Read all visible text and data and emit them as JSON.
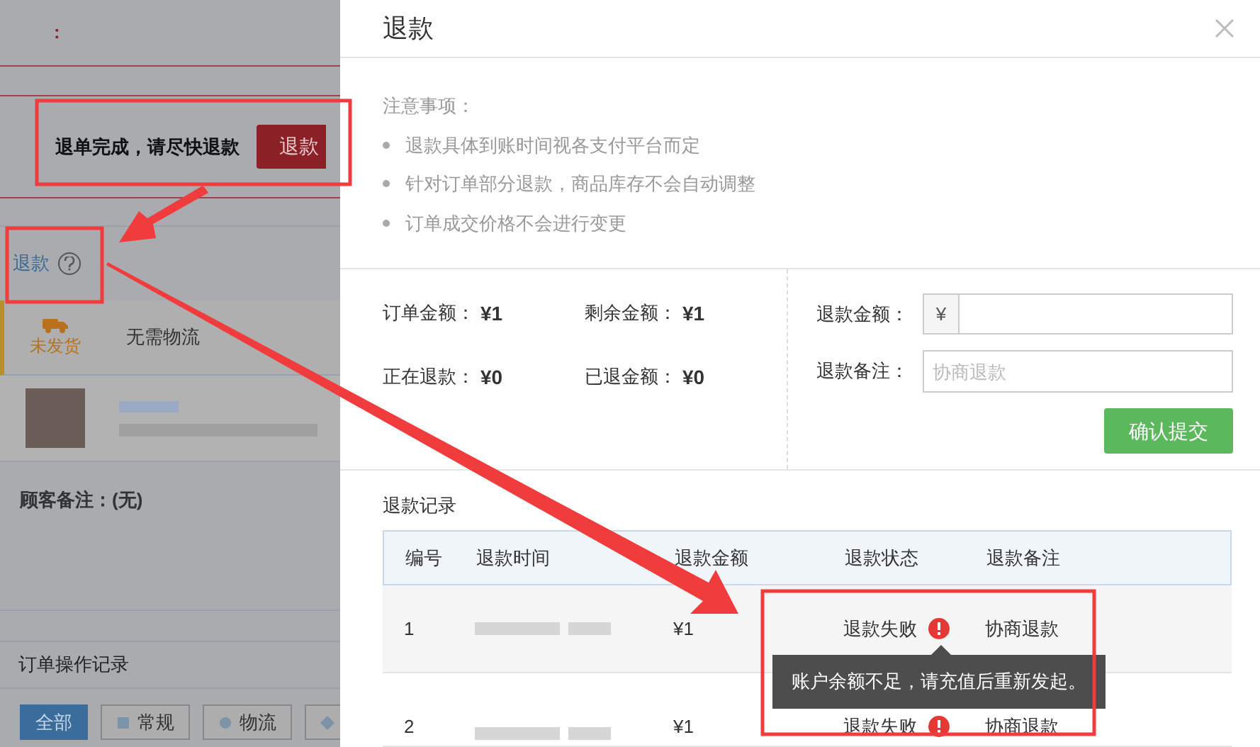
{
  "background_page": {
    "header_mark": ":",
    "banner": {
      "text": "退单完成，请尽快退款",
      "button": "退款"
    },
    "refund_link": "退款",
    "shipping": {
      "status": "未发货",
      "method": "无需物流"
    },
    "customer_note": "顾客备注：(无)",
    "log_title": "订单操作记录",
    "filters": [
      {
        "label": "全部",
        "selected": true,
        "kind": "plain"
      },
      {
        "label": "常规",
        "selected": false,
        "kind": "square"
      },
      {
        "label": "物流",
        "selected": false,
        "kind": "circle"
      },
      {
        "selected": false,
        "kind": "diamond"
      }
    ]
  },
  "dialog": {
    "title": "退款",
    "notes_title": "注意事项：",
    "notes": [
      "退款具体到账时间视各支付平台而定",
      "针对订单部分退款，商品库存不会自动调整",
      "订单成交价格不会进行变更"
    ],
    "amounts": [
      {
        "label": "订单金额：",
        "value": "¥1"
      },
      {
        "label": "剩余金额：",
        "value": "¥1"
      },
      {
        "label": "正在退款：",
        "value": "¥0"
      },
      {
        "label": "已退金额：",
        "value": "¥0"
      }
    ],
    "form": {
      "amount_label": "退款金额：",
      "currency": "¥",
      "note_label": "退款备注：",
      "note_placeholder": "协商退款",
      "submit": "确认提交"
    },
    "records_title": "退款记录",
    "columns": [
      "编号",
      "退款时间",
      "退款金额",
      "退款状态",
      "退款备注"
    ],
    "rows": [
      {
        "no": "1",
        "amount": "¥1",
        "status": "退款失败",
        "note": "协商退款"
      },
      {
        "no": "2",
        "amount": "¥1",
        "status": "退款失败",
        "note": "协商退款"
      }
    ],
    "tooltip": "账户余额不足，请充值后重新发起。"
  }
}
